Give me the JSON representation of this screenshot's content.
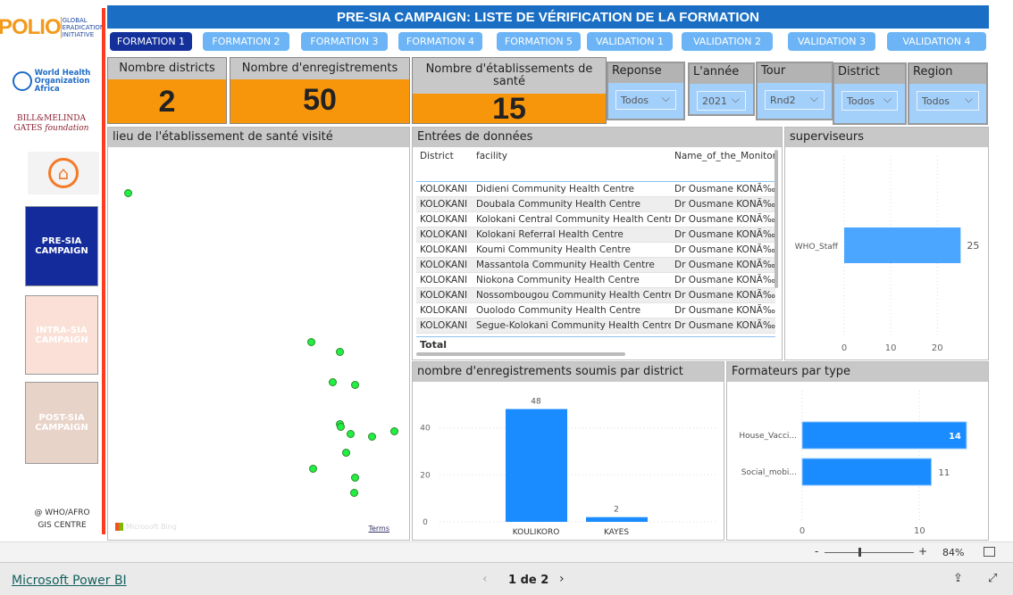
{
  "colors": {
    "title_bg": "#1a6fc4",
    "nav_active": "#14309a",
    "nav": "#6cb4f5",
    "kpi": "#f7950b",
    "bar": "#1a8cff",
    "map_point": "#22ee44",
    "accent_line": "#ff3b1f"
  },
  "sidebar": {
    "logos": [
      "POLIO GLOBAL ERADICATION INITIATIVE",
      "World Health Organization Africa",
      "BILL & MELINDA GATES foundation"
    ],
    "home_icon": "home-icon",
    "buttons": [
      {
        "label": "PRE-SIA CAMPAIGN"
      },
      {
        "label": "INTRA-SIA CAMPAIGN"
      },
      {
        "label": "POST-SIA CAMPAIGN"
      }
    ],
    "credit_line1": "@ WHO/AFRO",
    "credit_line2": "GIS CENTRE"
  },
  "header": {
    "title": "PRE-SIA CAMPAIGN: LISTE DE VÉRIFICATION DE LA FORMATION"
  },
  "tabs": [
    {
      "label": "FORMATION 1",
      "active": true
    },
    {
      "label": "FORMATION 2"
    },
    {
      "label": "FORMATION 3"
    },
    {
      "label": "FORMATION 4"
    },
    {
      "label": "FORMATION 5"
    },
    {
      "label": "VALIDATION 1"
    },
    {
      "label": "VALIDATION 2"
    },
    {
      "label": "VALIDATION 3"
    },
    {
      "label": "VALIDATION 4"
    }
  ],
  "kpis": [
    {
      "label": "Nombre districts",
      "value": "2"
    },
    {
      "label": "Nombre d'enregistrements",
      "value": "50"
    },
    {
      "label": "Nombre d'établissements de santé",
      "value": "15"
    }
  ],
  "slicers": [
    {
      "label": "Reponse",
      "value": "Todos"
    },
    {
      "label": "L'année",
      "value": "2021"
    },
    {
      "label": "Tour",
      "value": "Rnd2"
    },
    {
      "label": "District",
      "value": "Todos"
    },
    {
      "label": "Region",
      "value": "Todos"
    }
  ],
  "map": {
    "title": "lieu de l'établissement de santé visité",
    "attribution": "Microsoft Bing",
    "terms": "Terms"
  },
  "table": {
    "title": "Entrées de données",
    "columns": [
      "District",
      "facility",
      "Name_of_the_Monitor"
    ],
    "rows": [
      [
        "KOLOKANI",
        "Didieni Community Health Centre",
        "Dr Ousmane KONÃ‰"
      ],
      [
        "KOLOKANI",
        "Doubala Community Health Centre",
        "Dr Ousmane KONÃ‰"
      ],
      [
        "KOLOKANI",
        "Kolokani Central Community Health Centre",
        "Dr Ousmane KONÃ‰"
      ],
      [
        "KOLOKANI",
        "Kolokani Referral Health Centre",
        "Dr Ousmane KONÃ‰"
      ],
      [
        "KOLOKANI",
        "Koumi Community Health Centre",
        "Dr Ousmane KONÃ‰"
      ],
      [
        "KOLOKANI",
        "Massantola Community Health Centre",
        "Dr Ousmane KONÃ‰"
      ],
      [
        "KOLOKANI",
        "Niokona Community Health Centre",
        "Dr Ousmane KONÃ‰"
      ],
      [
        "KOLOKANI",
        "Nossombougou Community Health Centre",
        "Dr Ousmane KONÃ‰"
      ],
      [
        "KOLOKANI",
        "Ouolodo Community Health Centre",
        "Dr Ousmane KONÃ‰"
      ],
      [
        "KOLOKANI",
        "Segue-Kolokani Community Health Centre",
        "Dr Ousmane KONÃ‰"
      ]
    ],
    "total_label": "Total"
  },
  "chart_data": [
    {
      "type": "bar",
      "orientation": "horizontal",
      "title": "superviseurs",
      "categories": [
        "WHO_Staff"
      ],
      "values": [
        25
      ],
      "xticks": [
        0,
        10,
        20
      ],
      "xlim": [
        0,
        28
      ],
      "grid": true
    },
    {
      "type": "bar",
      "orientation": "vertical",
      "title": "nombre d'enregistrements soumis par district",
      "categories": [
        "KOULIKORO",
        "KAYES"
      ],
      "values": [
        48,
        2
      ],
      "yticks": [
        0,
        20,
        40
      ],
      "ylim": [
        0,
        52
      ],
      "grid": true
    },
    {
      "type": "bar",
      "orientation": "horizontal",
      "title": "Formateurs par type",
      "categories": [
        "House_Vacci...",
        "Social_mobi..."
      ],
      "values": [
        14,
        11
      ],
      "xticks": [
        0,
        10
      ],
      "xlim": [
        0,
        15
      ],
      "grid": true
    }
  ],
  "zoom": {
    "minus": "-",
    "plus": "+",
    "level": "84%"
  },
  "footer": {
    "brand": "Microsoft Power BI",
    "page": "1 de 2"
  }
}
